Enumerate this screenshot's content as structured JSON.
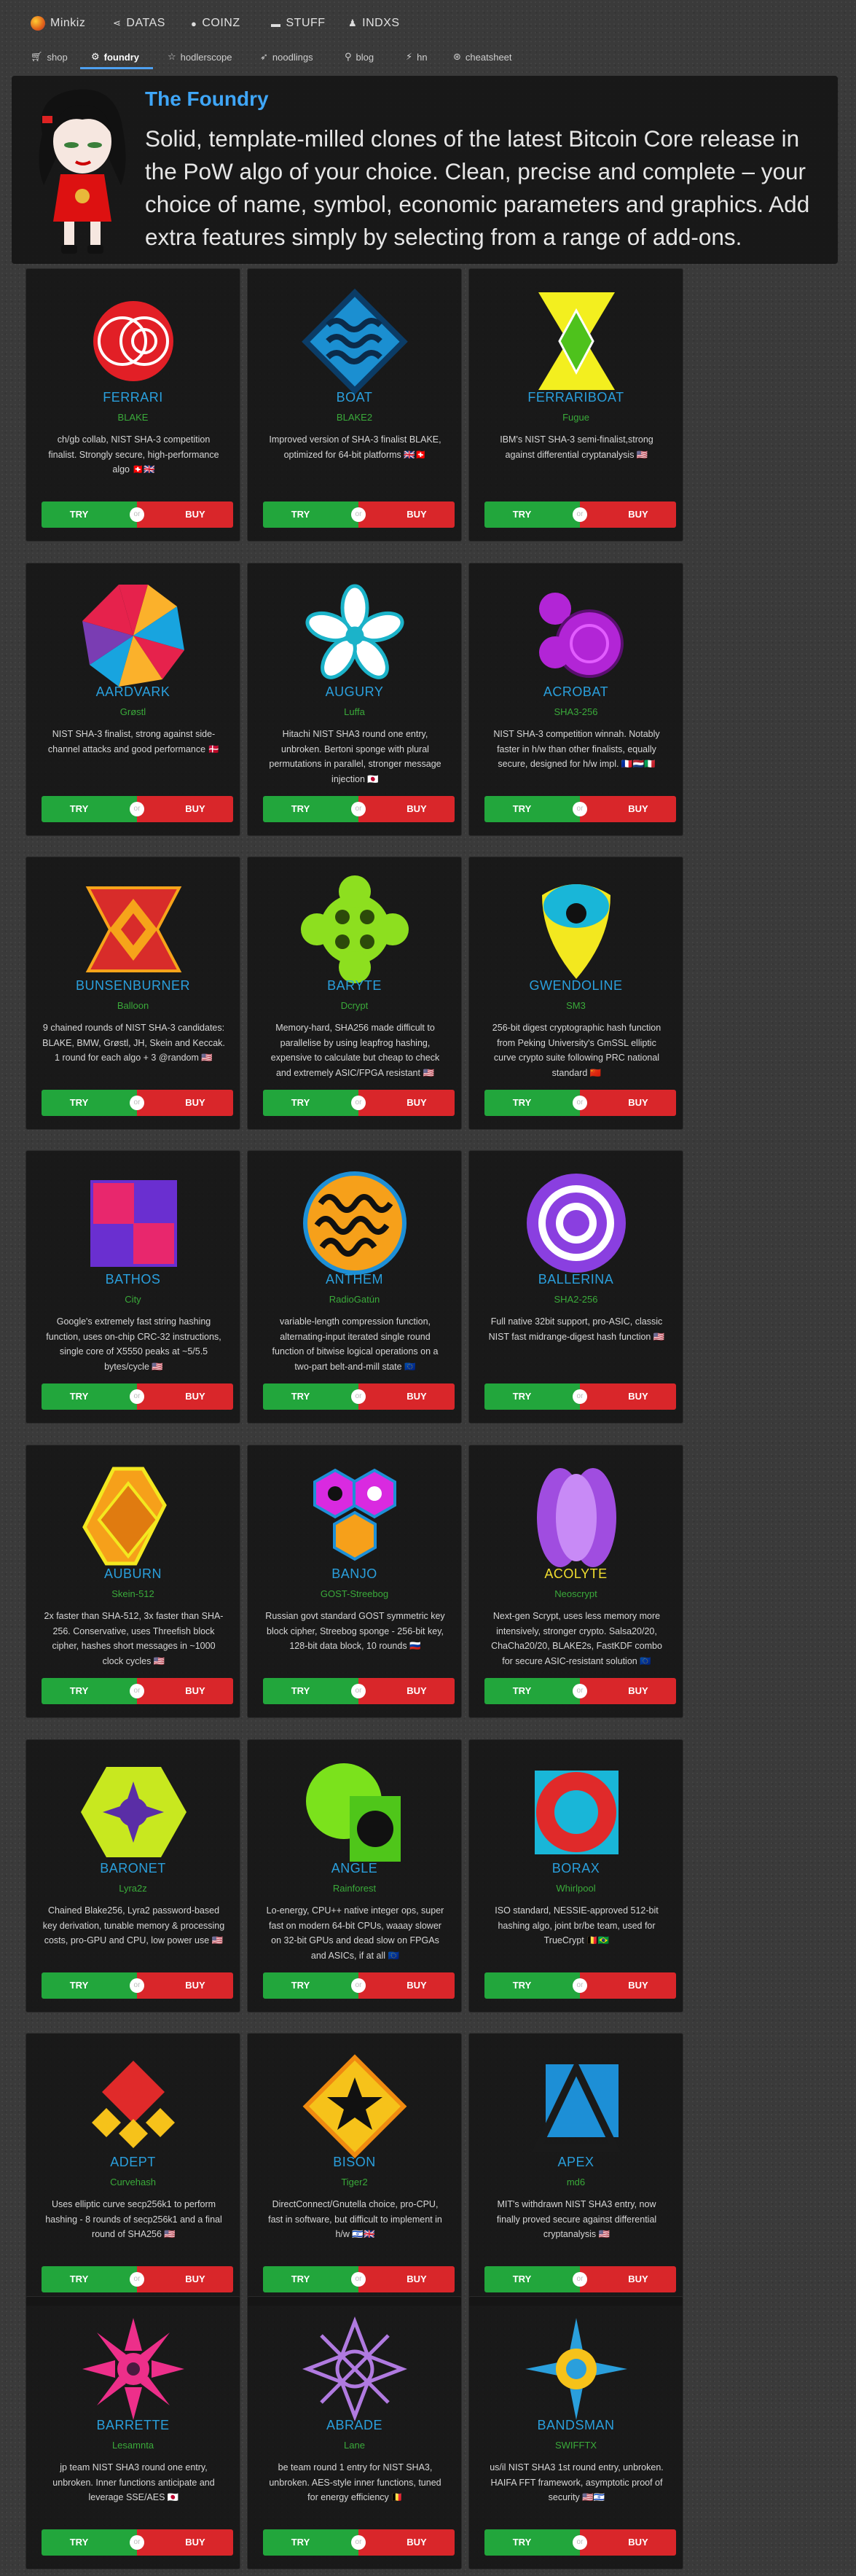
{
  "nav": {
    "brand": "Minkiz",
    "items": [
      {
        "label": "DATAS",
        "icon": "share-icon"
      },
      {
        "label": "COINZ",
        "icon": "coin-icon"
      },
      {
        "label": "STUFF",
        "icon": "folder-icon"
      },
      {
        "label": "INDXS",
        "icon": "user-icon"
      }
    ]
  },
  "subnav": {
    "items": [
      {
        "label": "shop",
        "icon": "cart-icon"
      },
      {
        "label": "foundry",
        "icon": "gear-icon"
      },
      {
        "label": "hodlerscope",
        "icon": "star-icon"
      },
      {
        "label": "noodlings",
        "icon": "rocket-icon"
      },
      {
        "label": "blog",
        "icon": "pin-icon"
      },
      {
        "label": "hn",
        "icon": "plug-icon"
      },
      {
        "label": "cheatsheet",
        "icon": "compass-icon"
      }
    ]
  },
  "banner": {
    "title": "The Foundry",
    "text": "Solid, template-milled clones of the latest Bitcoin Core release in the PoW algo of your choice. Clean, precise and complete – your choice of name, symbol, economic parameters and graphics. Add extra features simply by selecting from a range of add-ons."
  },
  "buttons": {
    "try": "TRY",
    "or": "or",
    "buy": "BUY"
  },
  "cards": [
    {
      "name": "FERRARI",
      "algo": "BLAKE",
      "desc": "ch/gb collab, NIST SHA-3 competition finalist. Strongly secure, high-performance algo 🇨🇭🇬🇧",
      "logo": "ferrari"
    },
    {
      "name": "BOAT",
      "algo": "BLAKE2",
      "desc": "Improved version of SHA-3 finalist BLAKE, optimized for 64-bit platforms 🇬🇧🇨🇭",
      "logo": "boat"
    },
    {
      "name": "FERRARIBOAT",
      "algo": "Fugue",
      "desc": "IBM's NIST SHA-3 semi-finalist,strong against differential cryptanalysis 🇺🇸",
      "logo": "ferrariboat"
    },
    {
      "name": "AARDVARK",
      "algo": "Grøstl",
      "desc": "NIST SHA-3 finalist, strong against side-channel attacks and good performance 🇩🇰",
      "logo": "aardvark"
    },
    {
      "name": "AUGURY",
      "algo": "Luffa",
      "desc": "Hitachi NIST SHA3 round one entry, unbroken. Bertoni sponge with plural permutations in parallel, stronger message injection 🇯🇵",
      "logo": "augury"
    },
    {
      "name": "ACROBAT",
      "algo": "SHA3-256",
      "desc": "NIST SHA-3 competition winnah. Notably faster in h/w than other finalists, equally secure, designed for h/w impl. 🇫🇷🇳🇱🇮🇹",
      "logo": "acrobat"
    },
    {
      "name": "BUNSENBURNER",
      "algo": "Balloon",
      "desc": "9 chained rounds of NIST SHA-3 candidates: BLAKE, BMW, Grøstl, JH, Skein and Keccak. 1 round for each algo + 3 @random 🇺🇸",
      "logo": "bunsen"
    },
    {
      "name": "BARYTE",
      "algo": "Dcrypt",
      "desc": "Memory-hard, SHA256 made difficult to parallelise by using leapfrog hashing, expensive to calculate but cheap to check and extremely ASIC/FPGA resistant 🇺🇸",
      "logo": "baryte"
    },
    {
      "name": "GWENDOLINE",
      "algo": "SM3",
      "desc": "256-bit digest cryptographic hash function from Peking University's GmSSL elliptic curve crypto suite following PRC national standard 🇨🇳",
      "logo": "gwendoline"
    },
    {
      "name": "BATHOS",
      "algo": "City",
      "desc": "Google's extremely fast string hashing function, uses on-chip CRC-32 instructions, single core of X5550 peaks at ~5/5.5 bytes/cycle 🇺🇸",
      "logo": "bathos"
    },
    {
      "name": "ANTHEM",
      "algo": "RadioGatún",
      "desc": "variable-length compression function, alternating-input iterated single round function of bitwise logical operations on a two-part belt-and-mill state 🇪🇺",
      "logo": "anthem"
    },
    {
      "name": "BALLERINA",
      "algo": "SHA2-256",
      "desc": "Full native 32bit support, pro-ASIC, classic NIST fast midrange-digest hash function 🇺🇸",
      "logo": "ballerina"
    },
    {
      "name": "AUBURN",
      "algo": "Skein-512",
      "desc": "2x faster than SHA-512, 3x faster than SHA-256. Conservative, uses Threefish block cipher, hashes short messages in ~1000 clock cycles 🇺🇸",
      "logo": "auburn"
    },
    {
      "name": "BANJO",
      "algo": "GOST-Streebog",
      "desc": "Russian govt standard GOST symmetric key block cipher, Streebog sponge - 256-bit key, 128-bit data block, 10 rounds 🇷🇺",
      "logo": "banjo"
    },
    {
      "name": "ACOLYTE",
      "algo": "Neoscrypt",
      "desc": "Next-gen Scrypt, uses less memory more intensively, stronger crypto. Salsa20/20, ChaCha20/20, BLAKE2s, FastKDF combo for secure ASIC-resistant solution 🇪🇺",
      "logo": "acolyte",
      "gold": true
    },
    {
      "name": "BARONET",
      "algo": "Lyra2z",
      "desc": "Chained Blake256, Lyra2 password-based key derivation, tunable memory & processing costs, pro-GPU and CPU, low power use 🇺🇸",
      "logo": "baronet"
    },
    {
      "name": "ANGLE",
      "algo": "Rainforest",
      "desc": "Lo-energy, CPU++ native integer ops, super fast on modern 64-bit CPUs, waaay slower on 32-bit GPUs and dead slow on FPGAs and ASICs, if at all 🇪🇺",
      "logo": "angle"
    },
    {
      "name": "BORAX",
      "algo": "Whirlpool",
      "desc": "ISO standard, NESSIE-approved 512-bit hashing algo, joint br/be team, used for TrueCrypt 🇧🇪🇧🇷",
      "logo": "borax"
    },
    {
      "name": "ADEPT",
      "algo": "Curvehash",
      "desc": "Uses elliptic curve secp256k1 to perform hashing - 8 rounds of secp256k1 and a final round of SHA256 🇺🇸",
      "logo": "adept"
    },
    {
      "name": "BISON",
      "algo": "Tiger2",
      "desc": "DirectConnect/Gnutella choice, pro-CPU, fast in software, but difficult to implement in h/w 🇮🇱🇬🇧",
      "logo": "bison"
    },
    {
      "name": "APEX",
      "algo": "md6",
      "desc": "MIT's withdrawn NIST SHA3 entry, now finally proved secure against differential cryptanalysis 🇺🇸",
      "logo": "apex"
    },
    {
      "name": "BARRETTE",
      "algo": "Lesamnta",
      "desc": "jp team NIST SHA3 round one entry, unbroken. Inner functions anticipate and leverage SSE/AES 🇯🇵",
      "logo": "barrette"
    },
    {
      "name": "ABRADE",
      "algo": "Lane",
      "desc": "be team round 1 entry for NIST SHA3, unbroken. AES-style inner functions, tuned for energy efficiency 🇧🇪",
      "logo": "abrade"
    },
    {
      "name": "BANDSMAN",
      "algo": "SWIFFTX",
      "desc": "us/il NIST SHA3 1st round entry, unbroken. HAIFA FFT framework, asymptotic proof of security 🇺🇸🇮🇱",
      "logo": "bandsman"
    }
  ]
}
